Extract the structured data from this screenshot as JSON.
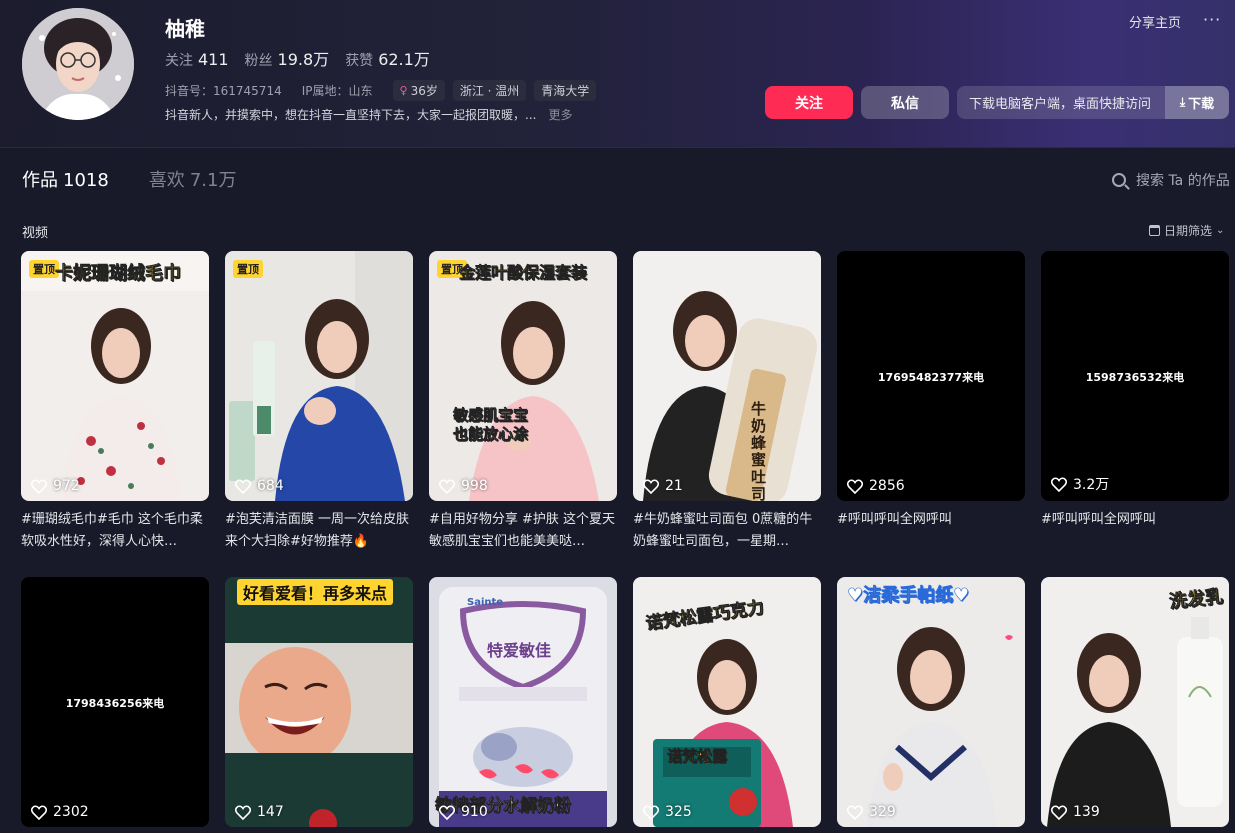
{
  "profile": {
    "name": "柚稚",
    "stats": [
      {
        "label": "关注",
        "value": "411"
      },
      {
        "label": "粉丝",
        "value": "19.8万"
      },
      {
        "label": "获赞",
        "value": "62.1万"
      }
    ],
    "douyin_id": "抖音号：161745714",
    "ip_location": "IP属地：山东",
    "tags": [
      "36岁",
      "浙江 · 温州",
      "青海大学"
    ],
    "bio": "抖音新人，并摸索中，想在抖音一直坚持下去，大家一起报团取暖，...",
    "bio_more": "更多"
  },
  "actions": {
    "share_home": "分享主页",
    "more": "···",
    "follow": "关注",
    "message": "私信",
    "download_text": "下载电脑客户端，桌面快捷访问",
    "download_btn": "下载"
  },
  "tabs": [
    {
      "label": "作品",
      "count": "1018",
      "active": true
    },
    {
      "label": "喜欢",
      "count": "7.1万",
      "active": false
    }
  ],
  "search_works": "搜索 Ta 的作品",
  "section_label": "视频",
  "date_filter": "日期筛选",
  "pinned_label": "置顶",
  "videos": [
    {
      "likes": "972",
      "caption": "#珊瑚绒毛巾#毛巾 这个毛巾柔软吸水性好，深得人心快…",
      "banner": "卡妮珊瑚绒毛巾",
      "pinned": true
    },
    {
      "likes": "684",
      "caption": "#泡芙清洁面膜 一周一次给皮肤来个大扫除#好物推荐🔥",
      "banner": "",
      "pinned": true
    },
    {
      "likes": "998",
      "caption": "#自用好物分享 #护肤 这个夏天敏感肌宝宝们也能美美哒…",
      "banner": "金莲叶酸保湿套装",
      "overlay": "敏感肌宝宝 也能放心涂",
      "pinned": true
    },
    {
      "likes": "21",
      "caption": "#牛奶蜂蜜吐司面包 0蔗糖的牛奶蜂蜜吐司面包，一星期…",
      "banner": "",
      "overlay": "牛奶蜂蜜吐司",
      "pinned": false
    },
    {
      "likes": "2856",
      "caption": "#呼叫呼叫全网呼叫",
      "center_text": "17695482377来电",
      "pinned": false
    },
    {
      "likes": "3.2万",
      "caption": "#呼叫呼叫全网呼叫",
      "center_text": "1598736532来电",
      "pinned": false
    },
    {
      "likes": "2302",
      "caption": "",
      "center_text": "1798436256来电",
      "pinned": false
    },
    {
      "likes": "147",
      "caption": "",
      "banner": "好看爱看！再多来点",
      "pinned": false
    },
    {
      "likes": "910",
      "caption": "",
      "banner": "敏特部分水解奶粉",
      "overlay": "特爱敏佳",
      "brand": "Sainte",
      "pinned": false
    },
    {
      "likes": "325",
      "caption": "",
      "banner": "诺梵松露巧克力",
      "overlay": "诺梵松露",
      "pinned": false
    },
    {
      "likes": "329",
      "caption": "",
      "banner": "♥洁柔手帕纸♥",
      "pinned": false
    },
    {
      "likes": "139",
      "caption": "",
      "banner": "洗发乳",
      "pinned": false
    }
  ],
  "colors": {
    "follow": "#fe2c55",
    "background": "#181929",
    "pin": "#ffd330"
  }
}
